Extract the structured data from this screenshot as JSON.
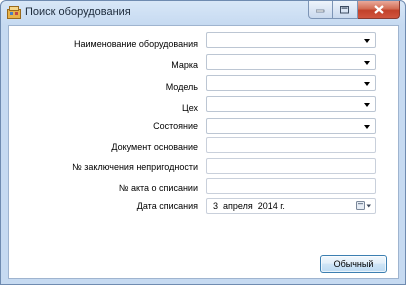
{
  "window": {
    "title": "Поиск оборудования",
    "caption_buttons": [
      "minimize-icon",
      "maximize-icon",
      "close-icon"
    ]
  },
  "form": {
    "fields": [
      {
        "label": "Наименование оборудования",
        "type": "combo",
        "value": ""
      },
      {
        "label": "Марка",
        "type": "combo",
        "value": ""
      },
      {
        "label": "Модель",
        "type": "combo",
        "value": ""
      },
      {
        "label": "Цех",
        "type": "combo",
        "value": ""
      },
      {
        "label": "Состояние",
        "type": "combo",
        "value": ""
      },
      {
        "label": "Документ основание",
        "type": "text",
        "value": ""
      },
      {
        "label": "№ заключения непригодности",
        "type": "text",
        "value": ""
      },
      {
        "label": "№ акта о списании",
        "type": "text",
        "value": ""
      },
      {
        "label": "Дата списания",
        "type": "date",
        "value": "3  апреля  2014 г."
      }
    ]
  },
  "buttons": {
    "normal_label": "Обычный"
  },
  "colors": {
    "title_text": "#1c2a3b",
    "close_button": "#c2412a",
    "frame": "#c6daf1"
  }
}
